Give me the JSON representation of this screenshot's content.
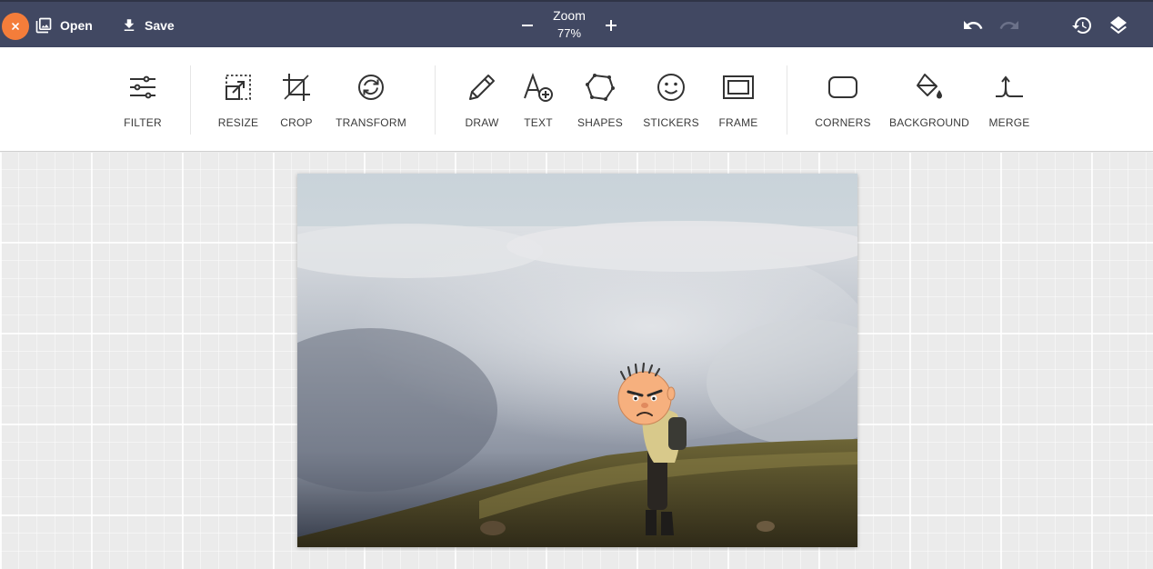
{
  "topbar": {
    "close_icon": "close-icon",
    "open_label": "Open",
    "save_label": "Save",
    "zoom_label": "Zoom",
    "zoom_value": "77%",
    "icons": [
      "image-icon",
      "download-icon",
      "minus-icon",
      "plus-icon",
      "undo-icon",
      "redo-icon",
      "history-icon",
      "layers-icon"
    ]
  },
  "toolbar": {
    "filter": "FILTER",
    "resize": "RESIZE",
    "crop": "CROP",
    "transform": "TRANSFORM",
    "draw": "DRAW",
    "text": "TEXT",
    "shapes": "SHAPES",
    "stickers": "STICKERS",
    "frame": "FRAME",
    "corners": "CORNERS",
    "background": "BACKGROUND",
    "merge": "MERGE"
  },
  "colors": {
    "topbar_bg": "#414862",
    "accent_orange": "#f47d3a",
    "canvas_bg": "#ebebeb"
  }
}
